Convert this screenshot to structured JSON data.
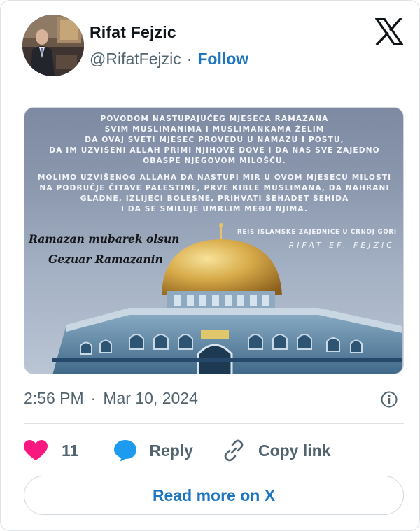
{
  "author": {
    "name": "Rifat Fejzic",
    "handle": "@RifatFejzic",
    "separator": "·",
    "follow_label": "Follow"
  },
  "media": {
    "message_block_1": [
      "POVODOM NASTUPAJUĆEG MJESECA RAMAZANA",
      "SVIM MUSLIMANIMA I MUSLIMANKAMA ŽELIM",
      "DA OVAJ SVETI MJESEC PROVEDU U NAMAZU I POSTU,",
      "DA IM UZVIŠENI ALLAH PRIMI NJIHOVE DOVE I DA NAS SVE ZAJEDNO",
      "OBASPE NJEGOVOM MILOŠĆU."
    ],
    "message_block_2": [
      "MOLIMO UZVIŠENOG ALLAHA DA NASTUPI MIR U OVOM MJESECU MILOSTI",
      "NA PODRUČJE ČITAVE PALESTINE, PRVE KIBLE MUSLIMANA, DA NAHRANI",
      "GLADNE, IZLIJEČI BOLESNE, PRIHVATI ŠEHADET ŠEHIDA",
      "I DA SE SMILUJE UMRLIM MEĐU NJIMA."
    ],
    "greeting_1": "Ramazan mubarek olsun",
    "greeting_2": "Gezuar Ramazanin",
    "signature_title": "REIS ISLAMSKE ZAJEDNICE U CRNOJ GORI",
    "signature_name": "RIFAT EF. FEJZIĆ"
  },
  "timestamp": {
    "time": "2:56 PM",
    "separator": "·",
    "date": "Mar 10, 2024"
  },
  "actions": {
    "like_count": "11",
    "reply_label": "Reply",
    "copy_link_label": "Copy link"
  },
  "read_more_label": "Read more on X",
  "colors": {
    "link": "#1d76c2",
    "like": "#f91880",
    "reply": "#1d9bf0",
    "muted": "#536471",
    "border": "#dfe3e6"
  }
}
